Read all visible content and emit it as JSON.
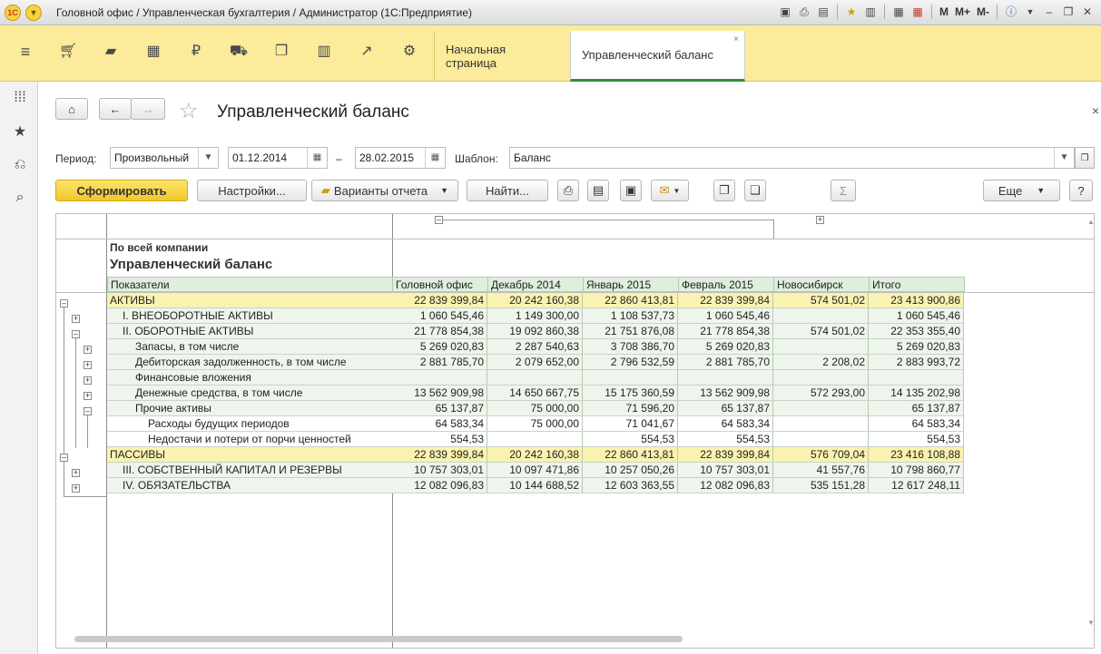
{
  "window": {
    "title": "Головной офис / Управленческая бухгалтерия / Администратор  (1С:Предприятие)",
    "logo": "1C",
    "toolbar_text": [
      "M",
      "M+",
      "M-"
    ]
  },
  "tabs": [
    {
      "label": "Начальная страница"
    },
    {
      "label": "Управленческий баланс",
      "close": "×"
    }
  ],
  "page": {
    "title": "Управленческий баланс",
    "close": "×"
  },
  "filters": {
    "period_label": "Период:",
    "period_type": "Произвольный",
    "date_from": "01.12.2014",
    "dash": "–",
    "date_to": "28.02.2015",
    "template_label": "Шаблон:",
    "template_value": "Баланс"
  },
  "buttons": {
    "generate": "Сформировать",
    "settings": "Настройки...",
    "variants": "Варианты отчета",
    "find": "Найти...",
    "more": "Еще",
    "help": "?",
    "sum": "Σ"
  },
  "report": {
    "scope": "По всей компании",
    "title": "Управленческий баланс",
    "col_indicators": "Показатели",
    "columns": [
      "Головной офис",
      "Декабрь 2014",
      "Январь 2015",
      "Февраль 2015",
      "Новосибирск",
      "Итого"
    ],
    "rows": [
      {
        "name": "АКТИВЫ",
        "values": [
          "22 839 399,84",
          "20 242 160,38",
          "22 860 413,81",
          "22 839 399,84",
          "574 501,02",
          "23 413 900,86"
        ]
      },
      {
        "name": "I. ВНЕОБОРОТНЫЕ АКТИВЫ",
        "values": [
          "1 060 545,46",
          "1 149 300,00",
          "1 108 537,73",
          "1 060 545,46",
          "",
          "1 060 545,46"
        ]
      },
      {
        "name": "II. ОБОРОТНЫЕ АКТИВЫ",
        "values": [
          "21 778 854,38",
          "19 092 860,38",
          "21 751 876,08",
          "21 778 854,38",
          "574 501,02",
          "22 353 355,40"
        ]
      },
      {
        "name": "Запасы, в том числе",
        "values": [
          "5 269 020,83",
          "2 287 540,63",
          "3 708 386,70",
          "5 269 020,83",
          "",
          "5 269 020,83"
        ]
      },
      {
        "name": "Дебиторская задолженность, в том числе",
        "values": [
          "2 881 785,70",
          "2 079 652,00",
          "2 796 532,59",
          "2 881 785,70",
          "2 208,02",
          "2 883 993,72"
        ]
      },
      {
        "name": "Финансовые вложения",
        "values": [
          "",
          "",
          "",
          "",
          "",
          ""
        ]
      },
      {
        "name": "Денежные средства, в том числе",
        "values": [
          "13 562 909,98",
          "14 650 667,75",
          "15 175 360,59",
          "13 562 909,98",
          "572 293,00",
          "14 135 202,98"
        ]
      },
      {
        "name": "Прочие активы",
        "values": [
          "65 137,87",
          "75 000,00",
          "71 596,20",
          "65 137,87",
          "",
          "65 137,87"
        ]
      },
      {
        "name": "Расходы будущих периодов",
        "values": [
          "64 583,34",
          "75 000,00",
          "71 041,67",
          "64 583,34",
          "",
          "64 583,34"
        ]
      },
      {
        "name": "Недостачи и потери от порчи ценностей",
        "values": [
          "554,53",
          "",
          "554,53",
          "554,53",
          "",
          "554,53"
        ]
      },
      {
        "name": "ПАССИВЫ",
        "values": [
          "22 839 399,84",
          "20 242 160,38",
          "22 860 413,81",
          "22 839 399,84",
          "576 709,04",
          "23 416 108,88"
        ]
      },
      {
        "name": "III. СОБСТВЕННЫЙ КАПИТАЛ И РЕЗЕРВЫ",
        "values": [
          "10 757 303,01",
          "10 097 471,86",
          "10 257 050,26",
          "10 757 303,01",
          "41 557,76",
          "10 798 860,77"
        ]
      },
      {
        "name": "IV. ОБЯЗАТЕЛЬСТВА",
        "values": [
          "12 082 096,83",
          "10 144 688,52",
          "12 603 363,55",
          "12 082 096,83",
          "535 151,28",
          "12 617 248,11"
        ]
      }
    ]
  }
}
